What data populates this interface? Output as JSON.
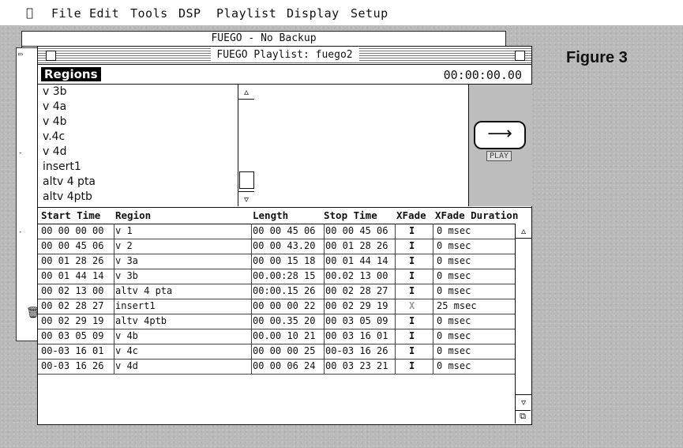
{
  "menubar": {
    "apple_icon": "apple-icon",
    "items": [
      "File",
      "Edit",
      "Tools",
      "DSP",
      "Playlist",
      "Display",
      "Setup"
    ]
  },
  "figure_label": "Figure 3",
  "back_window": {
    "title": "FUEGO - No Backup"
  },
  "main_window": {
    "title": "FUEGO Playlist: fuego2",
    "regions_label": "Regions",
    "time": "00:00:00.00",
    "regions": [
      "v 3b",
      "v 4a",
      "v 4b",
      "v.4c",
      "v 4d",
      "insert1",
      "altv 4 pta",
      "altv 4ptb"
    ],
    "play_label": "PLAY"
  },
  "table": {
    "headers": [
      "Start Time",
      "Region",
      "Length",
      "Stop Time",
      "XFade",
      "XFade Duration"
    ],
    "rows": [
      {
        "start": "00 00 00 00",
        "region": "v 1",
        "length": "00 00 45 06",
        "stop": "00 00 45 06",
        "xfade": "I",
        "duration": "0 msec"
      },
      {
        "start": "00 00 45 06",
        "region": "v 2",
        "length": "00 00 43.20",
        "stop": "00 01 28 26",
        "xfade": "I",
        "duration": "0 msec"
      },
      {
        "start": "00 01 28 26",
        "region": "v 3a",
        "length": "00 00 15 18",
        "stop": "00 01 44 14",
        "xfade": "I",
        "duration": "0 msec"
      },
      {
        "start": "00 01 44 14",
        "region": "v 3b",
        "length": "00.00:28 15",
        "stop": "00.02 13 00",
        "xfade": "I",
        "duration": "0 msec"
      },
      {
        "start": "00 02 13 00",
        "region": "altv 4 pta",
        "length": "00:00.15 26",
        "stop": "00 02 28 27",
        "xfade": "I",
        "duration": "0 msec"
      },
      {
        "start": "00 02 28 27",
        "region": "insert1",
        "length": "00 00 00 22",
        "stop": "00 02 29 19",
        "xfade": "X",
        "duration": "25 msec"
      },
      {
        "start": "00 02 29 19",
        "region": "altv 4ptb",
        "length": "00 00.35 20",
        "stop": "00 03 05 09",
        "xfade": "I",
        "duration": "0 msec"
      },
      {
        "start": "00 03 05 09",
        "region": "v 4b",
        "length": "00.00 10 21",
        "stop": "00 03 16 01",
        "xfade": "I",
        "duration": "0 msec"
      },
      {
        "start": "00-03 16 01",
        "region": "v 4c",
        "length": "00 00 00 25",
        "stop": "00-03 16 26",
        "xfade": "I",
        "duration": "0 msec"
      },
      {
        "start": "00-03 16 26",
        "region": "v 4d",
        "length": "00 00 06 24",
        "stop": "00 03 23 21",
        "xfade": "I",
        "duration": "0 msec"
      }
    ]
  }
}
